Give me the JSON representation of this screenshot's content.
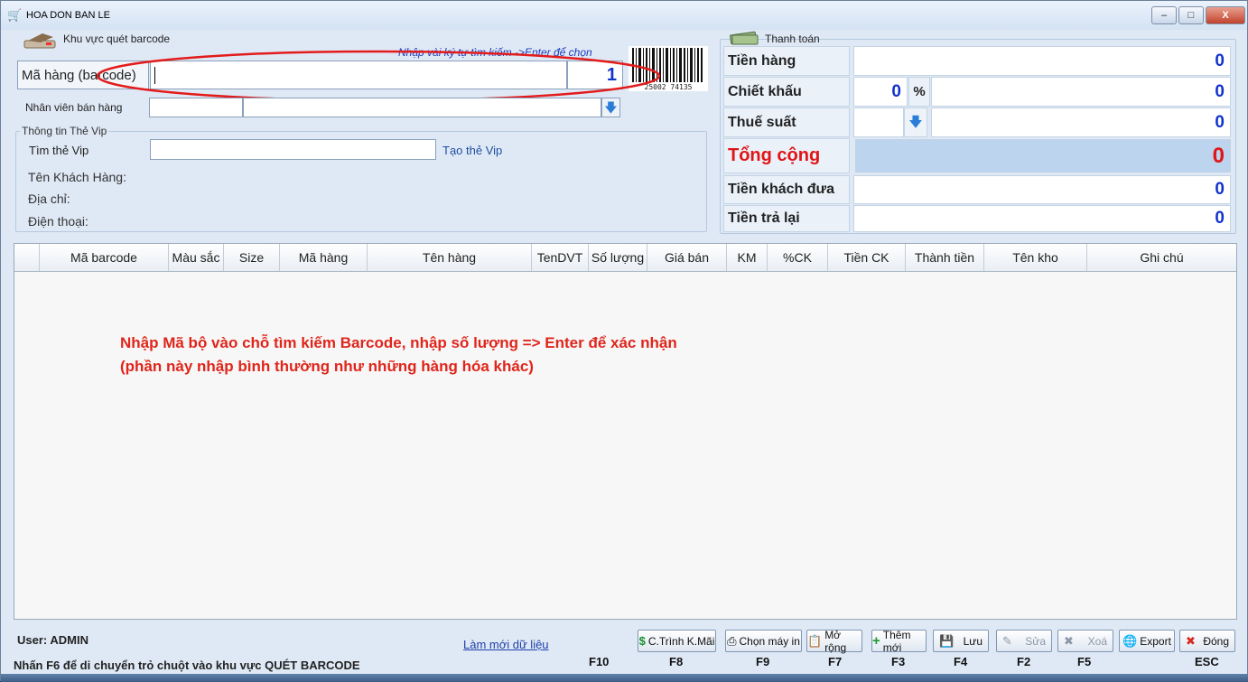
{
  "window": {
    "title": "HOA DON BAN LE",
    "controls": [
      "–",
      "□",
      "X"
    ]
  },
  "barcode_area": {
    "section_title": "Khu vực quét barcode",
    "hint": "Nhập vài ký tự tìm kiếm ->Enter để chọn",
    "item_code_label": "Mã hàng (barcode)",
    "item_code_value": "",
    "quantity": "1",
    "barcode_digits": "25002 74135",
    "salesperson_label": "Nhân viên bán hàng",
    "salesperson_value": ""
  },
  "vip": {
    "section_title": "Thông tin Thẻ Vip",
    "search_label": "Tìm thẻ Vip",
    "search_value": "",
    "create_link": "Tạo thẻ Vip",
    "customer_name_label": "Tên Khách Hàng:",
    "address_label": "Địa chỉ:",
    "phone_label": "Điện thoại:"
  },
  "payment": {
    "section_title": "Thanh toán",
    "subtotal_label": "Tiền hàng",
    "subtotal_value": "0",
    "discount_label": "Chiết khấu",
    "discount_pct": "0",
    "pct_symbol": "%",
    "discount_value": "0",
    "tax_label": "Thuế suất",
    "tax_value": "0",
    "total_label": "Tổng cộng",
    "total_value": "0",
    "paid_label": "Tiền khách đưa",
    "paid_value": "0",
    "change_label": "Tiền trả lại",
    "change_value": "0"
  },
  "grid": {
    "columns": [
      "",
      "Mã barcode",
      "Màu sắc",
      "Size",
      "Mã hàng",
      "Tên hàng",
      "TenDVT",
      "Số lượng",
      "Giá bán",
      "KM",
      "%CK",
      "Tiền CK",
      "Thành tiền",
      "Tên kho",
      "Ghi chú"
    ],
    "rows": []
  },
  "note": "Nhập Mã bộ vào chỗ tìm kiếm Barcode, nhập số lượng => Enter để xác nhận (phần này nhập bình thường như những hàng hóa khác)",
  "footer": {
    "user": "User: ADMIN",
    "hint": "Nhấn F6 để di chuyển trỏ chuột vào khu vực QUÉT BARCODE",
    "refresh_link": "Làm mới dữ liệu",
    "f10": "F10",
    "buttons": [
      {
        "label": "C.Trình K.Mãi",
        "key": "F8"
      },
      {
        "label": "Chọn máy in",
        "key": "F9"
      },
      {
        "label": "Mở rộng",
        "key": "F7"
      },
      {
        "label": "Thêm mới",
        "key": "F3"
      },
      {
        "label": "Lưu",
        "key": "F4"
      },
      {
        "label": "Sửa",
        "key": "F2"
      },
      {
        "label": "Xoá",
        "key": "F5"
      },
      {
        "label": "Export",
        "key": ""
      },
      {
        "label": "Đóng",
        "key": "ESC"
      }
    ]
  },
  "colors": {
    "background": "#dfe9f5",
    "value_blue": "#1133cc",
    "total_red": "#e01515",
    "note_red": "#e0251b",
    "annotation_red": "#e31b1b"
  }
}
